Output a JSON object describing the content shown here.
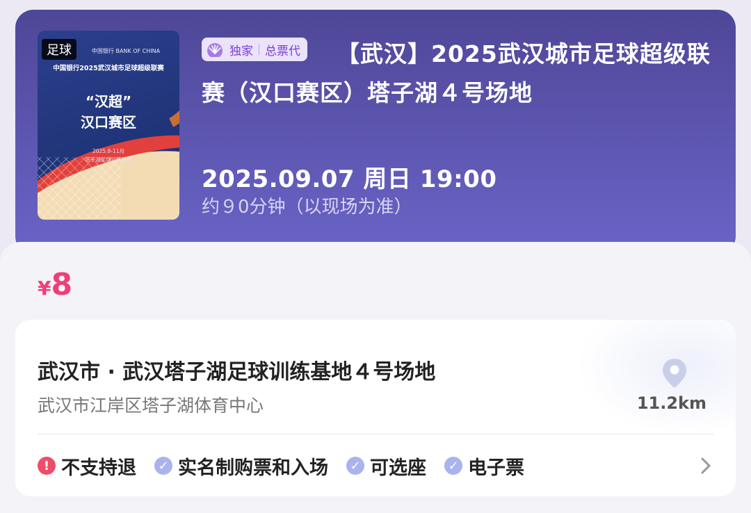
{
  "event": {
    "category_tag": "足球",
    "badge": {
      "exclusive": "独家",
      "agent": "总票代"
    },
    "title": "【武汉】2025武汉城市足球超级联赛（汉口赛区）塔子湖４号场地",
    "datetime": "2025.09.07 周日 19:00",
    "duration": "约９0分钟（以现场为准）"
  },
  "poster": {
    "logo_strip": "中国银行 BANK OF CHINA",
    "league": "中国银行2025武汉城市足球超级联赛",
    "headline1": "“汉超”",
    "headline2": "汉口赛区",
    "date_range": "2025.8-11月",
    "venue": "塔子湖足球训练基地"
  },
  "price": {
    "symbol": "¥",
    "amount": "8"
  },
  "venue": {
    "name": "武汉市 · 武汉塔子湖足球训练基地４号场地",
    "address": "武汉市江岸区塔子湖体育中心",
    "distance": "11.2km"
  },
  "policies": [
    {
      "label": "不支持退",
      "icon": "warning-icon"
    },
    {
      "label": "实名制购票和入场",
      "icon": "check-icon"
    },
    {
      "label": "可选座",
      "icon": "check-icon"
    },
    {
      "label": "电子票",
      "icon": "check-icon"
    }
  ],
  "colors": {
    "header_gradient_top": "#4e4797",
    "header_gradient_bottom": "#6a64c8",
    "price": "#ef3f78",
    "badge_text": "#7a3fd0",
    "warning": "#ee4d6a",
    "check": "#a9b4ee"
  }
}
